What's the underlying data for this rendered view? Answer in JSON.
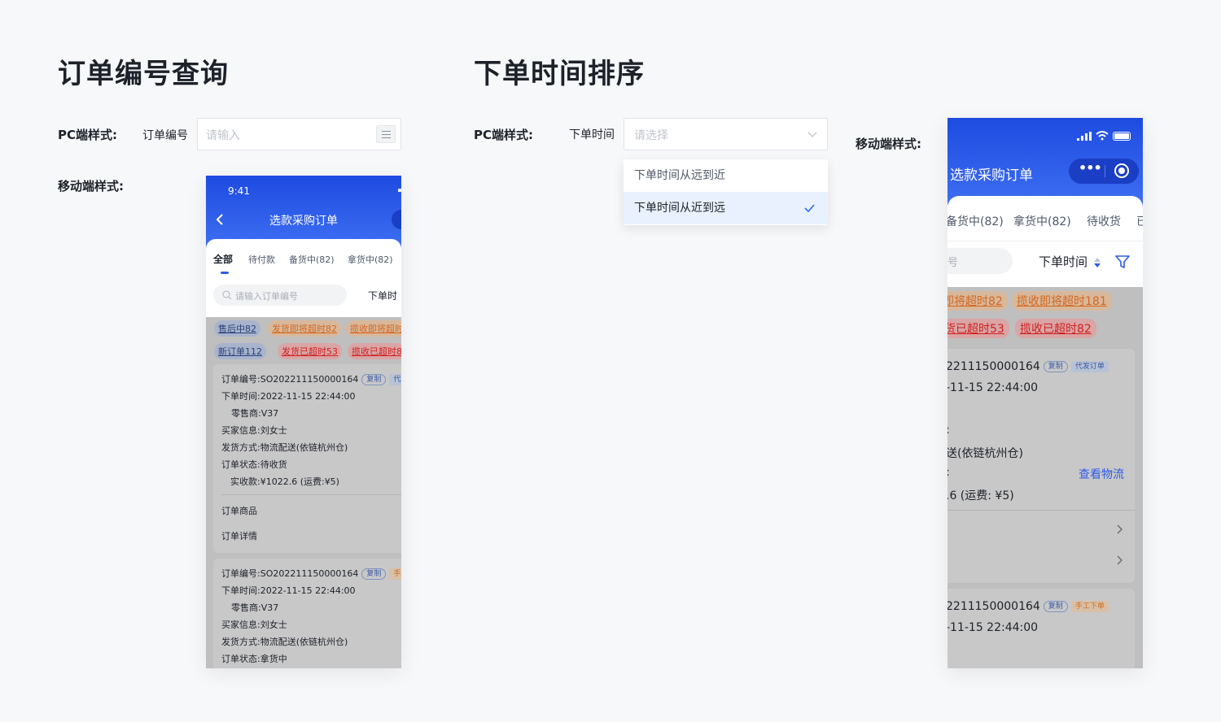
{
  "left": {
    "title": "订单编号查询",
    "pc_label": "PC端样式:",
    "field_label": "订单编号",
    "field_placeholder": "请输入",
    "mobile_label": "移动端样式:",
    "phone": {
      "time": "9:41",
      "nav_title": "选款采购订单",
      "tabs": [
        "全部",
        "待付款",
        "备货中(82)",
        "拿货中(82)"
      ],
      "search_placeholder": "请输入订单编号",
      "sort_label": "下单时",
      "tags_row1": [
        "售后中82",
        "发货即将超时82",
        "揽收即将超时"
      ],
      "tags_row2": [
        "新订单112",
        "发货已超时53",
        "揽收已超时8"
      ],
      "order1": {
        "no": "订单编号:SO202211150000164",
        "copy": "复制",
        "type": "代发",
        "time": "下单时间:2022-11-15 22:44:00",
        "retailer": "零售商:V37",
        "buyer": "买家信息:刘女士",
        "ship": "发货方式:物流配送(依链杭州仓)",
        "status": "订单状态:待收货",
        "amount": "实收款:¥1022.6 (运费:¥5)",
        "goods": "订单商品",
        "detail": "订单详情"
      },
      "order2": {
        "no": "订单编号:SO202211150000164",
        "copy": "复制",
        "type": "手工",
        "time": "下单时间:2022-11-15 22:44:00",
        "retailer": "零售商:V37",
        "buyer": "买家信息:刘女士",
        "ship": "发货方式:物流配送(依链杭州仓)",
        "status": "订单状态:拿货中"
      }
    }
  },
  "right": {
    "title": "下单时间排序",
    "pc_label": "PC端样式:",
    "field_label": "下单时间",
    "field_placeholder": "请选择",
    "options": [
      "下单时间从远到近",
      "下单时间从近到远"
    ],
    "selected_index": 1,
    "mobile_label": "移动端样式:",
    "phone": {
      "nav_title": "选款采购订单",
      "tabs": [
        "备货中(82)",
        "拿货中(82)",
        "待收货",
        "已"
      ],
      "search_placeholder": "号",
      "sort_label": "下单时间",
      "tags_row1": [
        "即将超时82",
        "揽收即将超时181"
      ],
      "tags_row2": [
        "货已超时53",
        "揽收已超时82"
      ],
      "order1": {
        "no": "2211150000164",
        "copy": "复制",
        "type": "代发订单",
        "time": "-11-15 22:44:00",
        "colon": ":",
        "ship": "送(依链杭州仓)",
        "colon2": ":",
        "logistics": "查看物流",
        "amount": ".6 (运费: ¥5)"
      },
      "order2": {
        "no": "2211150000164",
        "copy": "复制",
        "type": "手工下单",
        "time": "-11-15 22:44:00"
      }
    }
  },
  "colors": {
    "brand": "#2f5ce8",
    "check": "#2f6fe8",
    "page_bg": "#f7f8fa"
  }
}
